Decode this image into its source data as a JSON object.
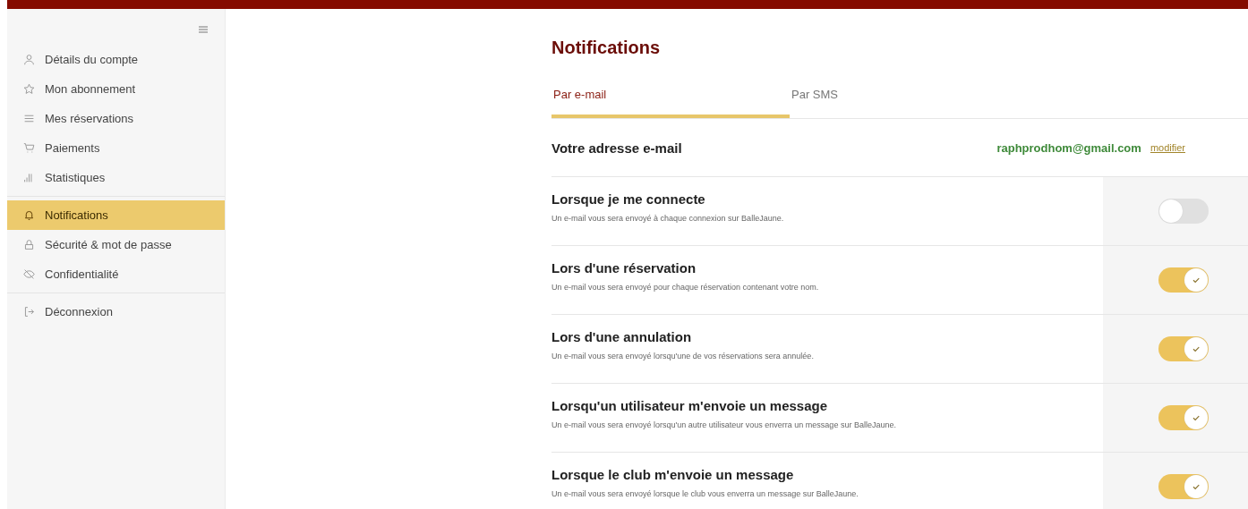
{
  "sidebar": {
    "groups": [
      {
        "items": [
          {
            "label": "Détails du compte",
            "selected": false
          },
          {
            "label": "Mon abonnement",
            "selected": false
          },
          {
            "label": "Mes réservations",
            "selected": false
          },
          {
            "label": "Paiements",
            "selected": false
          },
          {
            "label": "Statistiques",
            "selected": false
          }
        ]
      },
      {
        "items": [
          {
            "label": "Notifications",
            "selected": true
          },
          {
            "label": "Sécurité & mot de passe",
            "selected": false
          },
          {
            "label": "Confidentialité",
            "selected": false
          }
        ]
      },
      {
        "items": [
          {
            "label": "Déconnexion",
            "selected": false
          }
        ]
      }
    ]
  },
  "title": "Notifications",
  "tabs": [
    {
      "label": "Par e-mail",
      "selected": true
    },
    {
      "label": "Par SMS",
      "selected": false
    }
  ],
  "email": {
    "label": "Votre adresse e-mail",
    "value": "raphprodhom@gmail.com",
    "link": "modifier"
  },
  "settings": [
    {
      "title": "Lorsque je me connecte",
      "description": "Un e-mail vous sera envoyé à chaque connexion sur BalleJaune.",
      "on": false
    },
    {
      "title": "Lors d'une réservation",
      "description": "Un e-mail vous sera envoyé pour chaque réservation contenant votre nom.",
      "on": true
    },
    {
      "title": "Lors d'une annulation",
      "description": "Un e-mail vous sera envoyé lorsqu'une de vos réservations sera annulée.",
      "on": true
    },
    {
      "title": "Lorsqu'un utilisateur m'envoie un message",
      "description": "Un e-mail vous sera envoyé lorsqu'un autre utilisateur vous enverra un message sur BalleJaune.",
      "on": true
    },
    {
      "title": "Lorsque le club m'envoie un message",
      "description": "Un e-mail vous sera envoyé lorsque le club vous enverra un message sur BalleJaune.",
      "on": true
    }
  ]
}
